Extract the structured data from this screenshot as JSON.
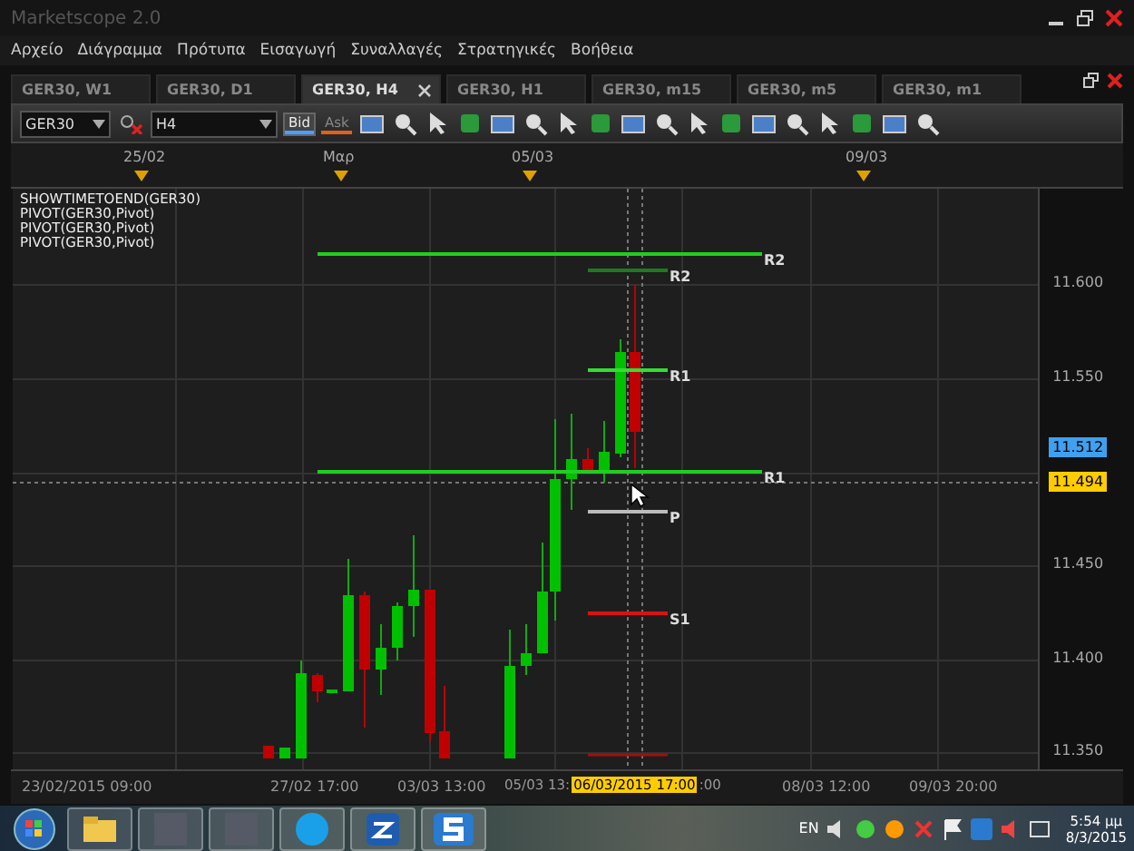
{
  "window": {
    "title": "Marketscope 2.0"
  },
  "menu": [
    "Αρχείο",
    "Διάγραμμα",
    "Πρότυπα",
    "Εισαγωγή",
    "Συναλλαγές",
    "Στρατηγικές",
    "Βοήθεια"
  ],
  "tabs": [
    {
      "label": "GER30, W1",
      "selected": false
    },
    {
      "label": "GER30, D1",
      "selected": false
    },
    {
      "label": "GER30, H4",
      "selected": true
    },
    {
      "label": "GER30, H1",
      "selected": false
    },
    {
      "label": "GER30, m15",
      "selected": false
    },
    {
      "label": "GER30, m5",
      "selected": false
    },
    {
      "label": "GER30, m1",
      "selected": false
    }
  ],
  "toolbar": {
    "symbol": "GER30",
    "timeframe": "H4",
    "price_modes": [
      {
        "label": "Bid",
        "selected": true
      },
      {
        "label": "Ask",
        "selected": false
      }
    ]
  },
  "top_axis": [
    "25/02",
    "Μαρ",
    "05/03",
    "09/03"
  ],
  "legend": [
    "SHOWTIMETOEND(GER30)",
    "PIVOT(GER30,Pivot)",
    "PIVOT(GER30,Pivot)",
    "PIVOT(GER30,Pivot)"
  ],
  "pivot_levels": [
    {
      "label": "R2",
      "color": "#22cc22"
    },
    {
      "label": "R2",
      "color": "#1f7a1f"
    },
    {
      "label": "R1",
      "color": "#33dd33"
    },
    {
      "label": "R1",
      "color": "#22cc22"
    },
    {
      "label": "P",
      "color": "#bbbbbb"
    },
    {
      "label": "S1",
      "color": "#dd1111"
    }
  ],
  "price_axis": [
    "11.600",
    "11.550",
    "11.450",
    "11.400",
    "11.350"
  ],
  "price_badges": [
    {
      "value": "11.512",
      "color": "#3fa0ef"
    },
    {
      "value": "11.494",
      "color": "#ffcc00"
    }
  ],
  "time_axis": [
    "23/02/2015 09:00",
    "27/02 17:00",
    "03/03 13:00",
    "05/03 13:",
    ":00",
    "08/03 12:00",
    "09/03 20:00"
  ],
  "cursor_time": "06/03/2015 17:00",
  "taskbar": {
    "language": "EN",
    "time": "5:54 μμ",
    "date": "8/3/2015"
  }
}
